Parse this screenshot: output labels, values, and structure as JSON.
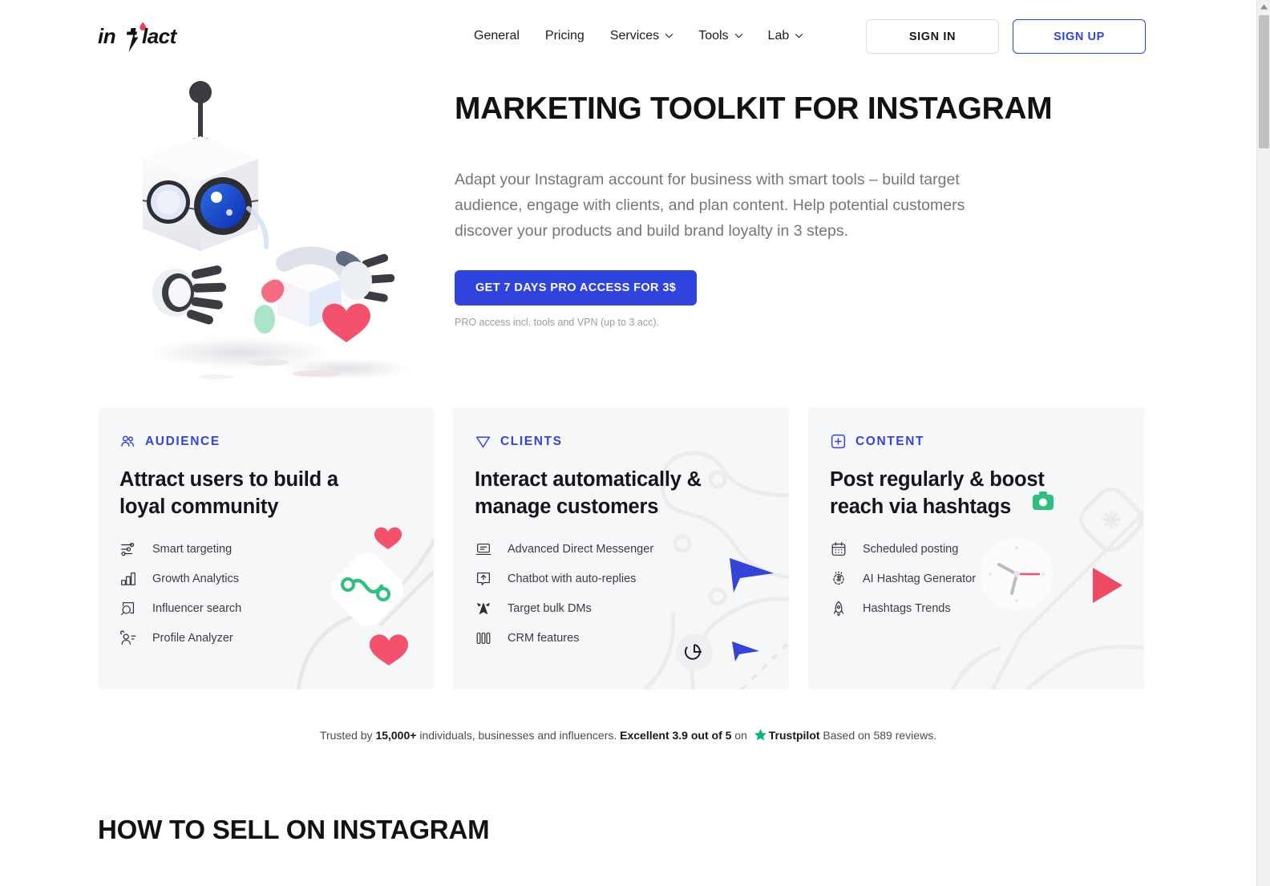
{
  "brand": {
    "name": "inflact",
    "accent": "#2f44df",
    "accent_drop": "#ef3e57"
  },
  "nav": {
    "items": [
      {
        "label": "General",
        "has_dropdown": false
      },
      {
        "label": "Pricing",
        "has_dropdown": false
      },
      {
        "label": "Services",
        "has_dropdown": true
      },
      {
        "label": "Tools",
        "has_dropdown": true
      },
      {
        "label": "Lab",
        "has_dropdown": true
      }
    ],
    "sign_in": "SIGN IN",
    "sign_up": "SIGN UP"
  },
  "hero": {
    "title": "MARKETING TOOLKIT FOR INSTAGRAM",
    "subtitle": "Adapt your Instagram account for business with smart tools – build target audience, engage with clients, and plan content. Help potential customers discover your products and build brand loyalty in 3 steps.",
    "cta_label": "GET 7 DAYS PRO ACCESS FOR 3$",
    "cta_note": "PRO access incl. tools and VPN (up to 3 acc)."
  },
  "cards": [
    {
      "kicker": "AUDIENCE",
      "kicker_icon": "users-icon",
      "title": "Attract users to build a loyal community",
      "features": [
        {
          "label": "Smart targeting",
          "icon": "sliders-icon"
        },
        {
          "label": "Growth Analytics",
          "icon": "bar-chart-icon"
        },
        {
          "label": "Influencer search",
          "icon": "search-frame-icon"
        },
        {
          "label": "Profile Analyzer",
          "icon": "profile-lines-icon"
        }
      ]
    },
    {
      "kicker": "CLIENTS",
      "kicker_icon": "send-icon",
      "title": "Interact automatically & manage customers",
      "features": [
        {
          "label": "Advanced Direct Messenger",
          "icon": "messenger-icon"
        },
        {
          "label": "Chatbot with auto-replies",
          "icon": "chatbot-icon"
        },
        {
          "label": "Target bulk DMs",
          "icon": "target-send-icon"
        },
        {
          "label": "CRM features",
          "icon": "columns-icon"
        }
      ]
    },
    {
      "kicker": "CONTENT",
      "kicker_icon": "plus-square-icon",
      "title": "Post regularly & boost reach via hashtags",
      "features": [
        {
          "label": "Scheduled posting",
          "icon": "calendar-icon"
        },
        {
          "label": "AI Hashtag Generator",
          "icon": "hashtag-gear-icon"
        },
        {
          "label": "Hashtags Trends",
          "icon": "rocket-icon"
        }
      ]
    }
  ],
  "trust": {
    "prefix": "Trusted by ",
    "count": "15,000+",
    "middle": " individuals, businesses and influencers. ",
    "rating": "Excellent 3.9 out of 5",
    "on": " on ",
    "platform": "Trustpilot",
    "suffix": " Based on 589 reviews.",
    "star_color": "#00b67a"
  },
  "section": {
    "how_title": "HOW TO SELL ON INSTAGRAM"
  }
}
